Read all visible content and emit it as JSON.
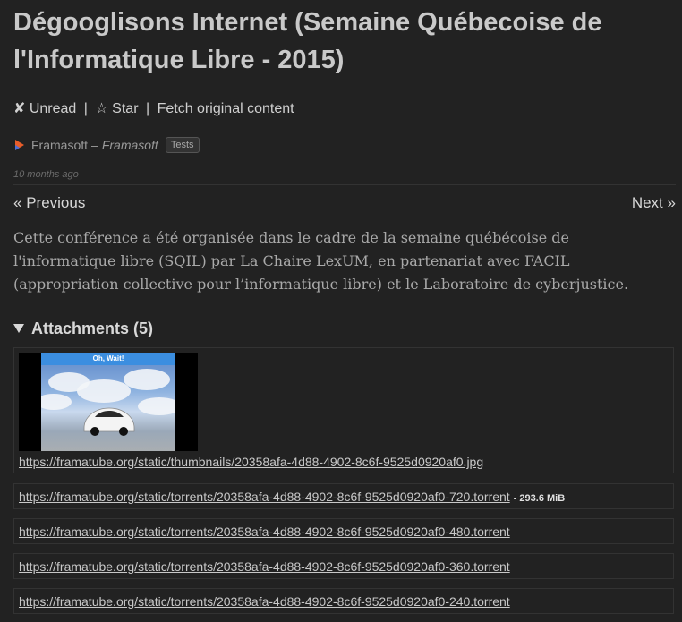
{
  "article": {
    "title": "Dégooglisons Internet (Semaine Québecoise de l'Informatique Libre - 2015)",
    "actions": {
      "unread_label": "✘ Unread",
      "star_label": "☆ Star",
      "fetch_label": "Fetch original content",
      "separator": "|"
    },
    "feed": {
      "name": "Framasoft",
      "dash": "–",
      "site_title": "Framasoft",
      "category_tag": "Tests"
    },
    "published": "10 months ago",
    "nav": {
      "previous_prefix": "«",
      "previous_label": "Previous",
      "next_label": "Next",
      "next_suffix": "»"
    },
    "content": "Cette conférence a été organisée dans le cadre de la semaine québécoise de l'informatique libre (SQIL) par La Chaire LexUM, en partenariat avec FACIL (appropriation collective pour l’informatique libre) et le Laboratoire de cyberjustice."
  },
  "attachments": {
    "summary": "Attachments (5)",
    "thumbnail_banner": "Oh, Wait!",
    "items": [
      {
        "url": "https://framatube.org/static/thumbnails/20358afa-4d88-4902-8c6f-9525d0920af0.jpg",
        "size": ""
      },
      {
        "url": "https://framatube.org/static/torrents/20358afa-4d88-4902-8c6f-9525d0920af0-720.torrent",
        "size": "- 293.6 MiB"
      },
      {
        "url": "https://framatube.org/static/torrents/20358afa-4d88-4902-8c6f-9525d0920af0-480.torrent",
        "size": ""
      },
      {
        "url": "https://framatube.org/static/torrents/20358afa-4d88-4902-8c6f-9525d0920af0-360.torrent",
        "size": ""
      },
      {
        "url": "https://framatube.org/static/torrents/20358afa-4d88-4902-8c6f-9525d0920af0-240.torrent",
        "size": ""
      }
    ]
  },
  "icons": {
    "feed_icon": "framasoft-play-icon",
    "disclosure": "triangle-down-icon"
  },
  "colors": {
    "background": "#222222",
    "text": "#c8c8c8",
    "muted": "#9a9a9a",
    "border": "#333333",
    "feed_icon_orange": "#e85d2a",
    "feed_icon_blue": "#4a6fd8"
  }
}
